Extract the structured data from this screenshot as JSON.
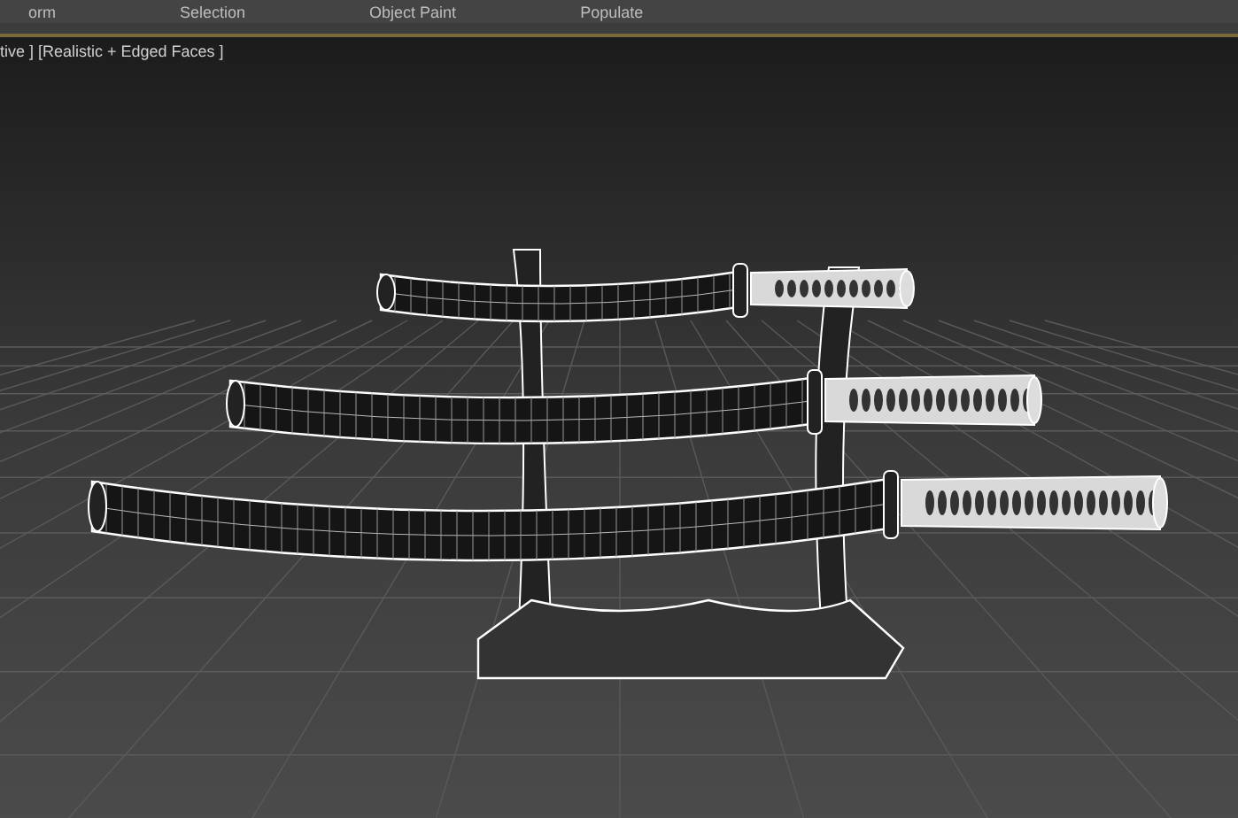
{
  "ribbon": {
    "tabs": [
      {
        "label": "orm",
        "selected": false
      },
      {
        "label": "Selection",
        "selected": false
      },
      {
        "label": "Object Paint",
        "selected": false
      },
      {
        "label": "Populate",
        "selected": false
      }
    ]
  },
  "viewport": {
    "label": "tive ] [Realistic + Edged Faces ]"
  }
}
